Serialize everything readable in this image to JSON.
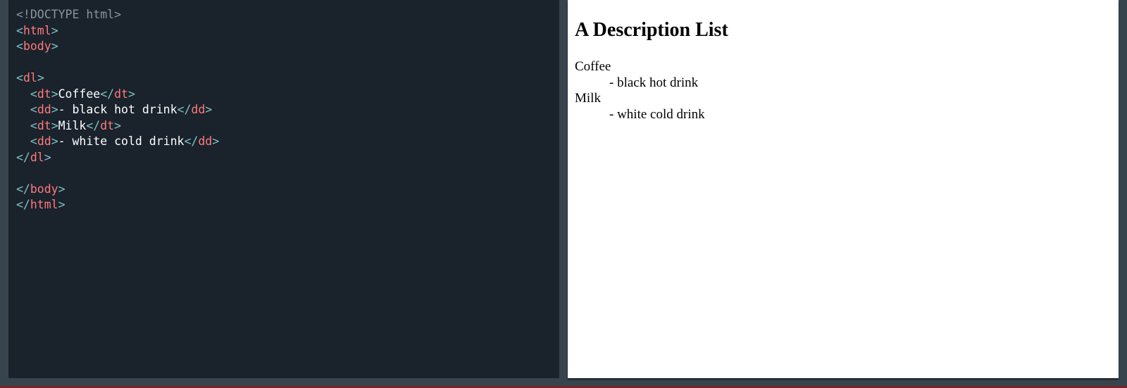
{
  "editor": {
    "lines": [
      [
        {
          "t": "<!DOCTYPE html>",
          "c": "doctype"
        }
      ],
      [
        {
          "t": "<",
          "c": "punct"
        },
        {
          "t": "html",
          "c": "tag"
        },
        {
          "t": ">",
          "c": "punct"
        }
      ],
      [
        {
          "t": "<",
          "c": "punct"
        },
        {
          "t": "body",
          "c": "tag"
        },
        {
          "t": ">",
          "c": "punct"
        }
      ],
      [],
      [
        {
          "t": "<",
          "c": "punct"
        },
        {
          "t": "dl",
          "c": "tag"
        },
        {
          "t": ">",
          "c": "punct"
        }
      ],
      [
        {
          "t": "  <",
          "c": "punct"
        },
        {
          "t": "dt",
          "c": "tag"
        },
        {
          "t": ">",
          "c": "punct"
        },
        {
          "t": "Coffee",
          "c": "text"
        },
        {
          "t": "</",
          "c": "punct"
        },
        {
          "t": "dt",
          "c": "tag"
        },
        {
          "t": ">",
          "c": "punct"
        }
      ],
      [
        {
          "t": "  <",
          "c": "punct"
        },
        {
          "t": "dd",
          "c": "tag"
        },
        {
          "t": ">",
          "c": "punct"
        },
        {
          "t": "- black hot drink",
          "c": "text"
        },
        {
          "t": "</",
          "c": "punct"
        },
        {
          "t": "dd",
          "c": "tag"
        },
        {
          "t": ">",
          "c": "punct"
        }
      ],
      [
        {
          "t": "  <",
          "c": "punct"
        },
        {
          "t": "dt",
          "c": "tag"
        },
        {
          "t": ">",
          "c": "punct"
        },
        {
          "t": "Milk",
          "c": "text"
        },
        {
          "t": "</",
          "c": "punct"
        },
        {
          "t": "dt",
          "c": "tag"
        },
        {
          "t": ">",
          "c": "punct"
        }
      ],
      [
        {
          "t": "  <",
          "c": "punct"
        },
        {
          "t": "dd",
          "c": "tag"
        },
        {
          "t": ">",
          "c": "punct"
        },
        {
          "t": "- white cold drink",
          "c": "text"
        },
        {
          "t": "</",
          "c": "punct"
        },
        {
          "t": "dd",
          "c": "tag"
        },
        {
          "t": ">",
          "c": "punct"
        }
      ],
      [
        {
          "t": "</",
          "c": "punct"
        },
        {
          "t": "dl",
          "c": "tag"
        },
        {
          "t": ">",
          "c": "punct"
        }
      ],
      [],
      [
        {
          "t": "</",
          "c": "punct"
        },
        {
          "t": "body",
          "c": "tag"
        },
        {
          "t": ">",
          "c": "punct"
        }
      ],
      [
        {
          "t": "</",
          "c": "punct"
        },
        {
          "t": "html",
          "c": "tag"
        },
        {
          "t": ">",
          "c": "punct"
        }
      ]
    ]
  },
  "preview": {
    "heading": "A Description List",
    "items": [
      {
        "term": "Coffee",
        "desc": "- black hot drink"
      },
      {
        "term": "Milk",
        "desc": "- white cold drink"
      }
    ]
  },
  "colors": {
    "editor_bg": "#1a222c",
    "tag": "#ff7a7a",
    "punct": "#7ec3c3",
    "doctype": "#8a949e",
    "text": "#ffffff",
    "preview_bg": "#ffffff",
    "accent_bar": "#7a2326"
  }
}
